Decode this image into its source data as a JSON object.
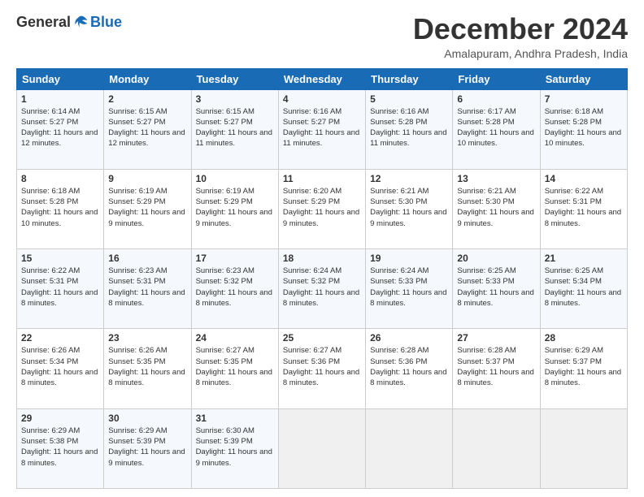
{
  "logo": {
    "general": "General",
    "blue": "Blue"
  },
  "title": "December 2024",
  "location": "Amalapuram, Andhra Pradesh, India",
  "days_header": [
    "Sunday",
    "Monday",
    "Tuesday",
    "Wednesday",
    "Thursday",
    "Friday",
    "Saturday"
  ],
  "weeks": [
    [
      {
        "day": "1",
        "sunrise": "6:14 AM",
        "sunset": "5:27 PM",
        "daylight": "11 hours and 12 minutes."
      },
      {
        "day": "2",
        "sunrise": "6:15 AM",
        "sunset": "5:27 PM",
        "daylight": "11 hours and 12 minutes."
      },
      {
        "day": "3",
        "sunrise": "6:15 AM",
        "sunset": "5:27 PM",
        "daylight": "11 hours and 11 minutes."
      },
      {
        "day": "4",
        "sunrise": "6:16 AM",
        "sunset": "5:27 PM",
        "daylight": "11 hours and 11 minutes."
      },
      {
        "day": "5",
        "sunrise": "6:16 AM",
        "sunset": "5:28 PM",
        "daylight": "11 hours and 11 minutes."
      },
      {
        "day": "6",
        "sunrise": "6:17 AM",
        "sunset": "5:28 PM",
        "daylight": "11 hours and 10 minutes."
      },
      {
        "day": "7",
        "sunrise": "6:18 AM",
        "sunset": "5:28 PM",
        "daylight": "11 hours and 10 minutes."
      }
    ],
    [
      {
        "day": "8",
        "sunrise": "6:18 AM",
        "sunset": "5:28 PM",
        "daylight": "11 hours and 10 minutes."
      },
      {
        "day": "9",
        "sunrise": "6:19 AM",
        "sunset": "5:29 PM",
        "daylight": "11 hours and 9 minutes."
      },
      {
        "day": "10",
        "sunrise": "6:19 AM",
        "sunset": "5:29 PM",
        "daylight": "11 hours and 9 minutes."
      },
      {
        "day": "11",
        "sunrise": "6:20 AM",
        "sunset": "5:29 PM",
        "daylight": "11 hours and 9 minutes."
      },
      {
        "day": "12",
        "sunrise": "6:21 AM",
        "sunset": "5:30 PM",
        "daylight": "11 hours and 9 minutes."
      },
      {
        "day": "13",
        "sunrise": "6:21 AM",
        "sunset": "5:30 PM",
        "daylight": "11 hours and 9 minutes."
      },
      {
        "day": "14",
        "sunrise": "6:22 AM",
        "sunset": "5:31 PM",
        "daylight": "11 hours and 8 minutes."
      }
    ],
    [
      {
        "day": "15",
        "sunrise": "6:22 AM",
        "sunset": "5:31 PM",
        "daylight": "11 hours and 8 minutes."
      },
      {
        "day": "16",
        "sunrise": "6:23 AM",
        "sunset": "5:31 PM",
        "daylight": "11 hours and 8 minutes."
      },
      {
        "day": "17",
        "sunrise": "6:23 AM",
        "sunset": "5:32 PM",
        "daylight": "11 hours and 8 minutes."
      },
      {
        "day": "18",
        "sunrise": "6:24 AM",
        "sunset": "5:32 PM",
        "daylight": "11 hours and 8 minutes."
      },
      {
        "day": "19",
        "sunrise": "6:24 AM",
        "sunset": "5:33 PM",
        "daylight": "11 hours and 8 minutes."
      },
      {
        "day": "20",
        "sunrise": "6:25 AM",
        "sunset": "5:33 PM",
        "daylight": "11 hours and 8 minutes."
      },
      {
        "day": "21",
        "sunrise": "6:25 AM",
        "sunset": "5:34 PM",
        "daylight": "11 hours and 8 minutes."
      }
    ],
    [
      {
        "day": "22",
        "sunrise": "6:26 AM",
        "sunset": "5:34 PM",
        "daylight": "11 hours and 8 minutes."
      },
      {
        "day": "23",
        "sunrise": "6:26 AM",
        "sunset": "5:35 PM",
        "daylight": "11 hours and 8 minutes."
      },
      {
        "day": "24",
        "sunrise": "6:27 AM",
        "sunset": "5:35 PM",
        "daylight": "11 hours and 8 minutes."
      },
      {
        "day": "25",
        "sunrise": "6:27 AM",
        "sunset": "5:36 PM",
        "daylight": "11 hours and 8 minutes."
      },
      {
        "day": "26",
        "sunrise": "6:28 AM",
        "sunset": "5:36 PM",
        "daylight": "11 hours and 8 minutes."
      },
      {
        "day": "27",
        "sunrise": "6:28 AM",
        "sunset": "5:37 PM",
        "daylight": "11 hours and 8 minutes."
      },
      {
        "day": "28",
        "sunrise": "6:29 AM",
        "sunset": "5:37 PM",
        "daylight": "11 hours and 8 minutes."
      }
    ],
    [
      {
        "day": "29",
        "sunrise": "6:29 AM",
        "sunset": "5:38 PM",
        "daylight": "11 hours and 8 minutes."
      },
      {
        "day": "30",
        "sunrise": "6:29 AM",
        "sunset": "5:39 PM",
        "daylight": "11 hours and 9 minutes."
      },
      {
        "day": "31",
        "sunrise": "6:30 AM",
        "sunset": "5:39 PM",
        "daylight": "11 hours and 9 minutes."
      },
      null,
      null,
      null,
      null
    ]
  ],
  "labels": {
    "sunrise": "Sunrise:",
    "sunset": "Sunset:",
    "daylight": "Daylight:"
  }
}
